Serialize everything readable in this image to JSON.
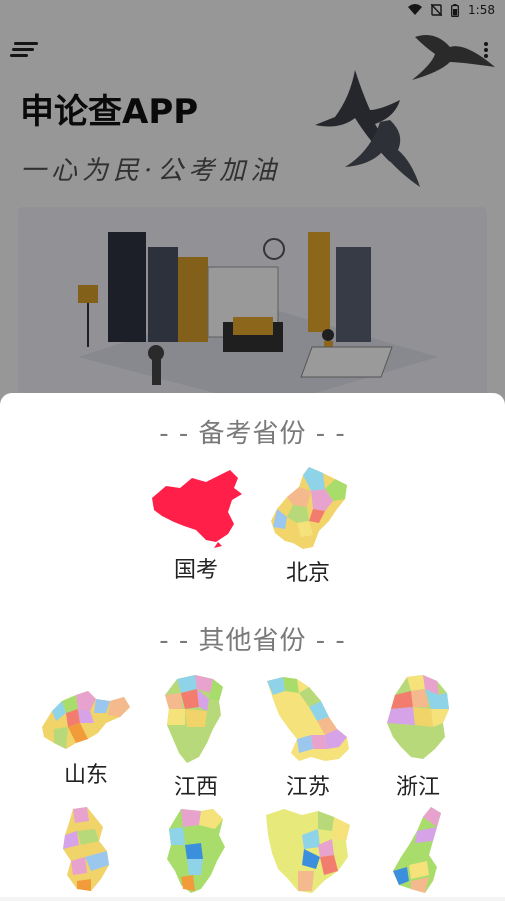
{
  "status_bar": {
    "time": "1:58"
  },
  "header": {
    "title": "申论查APP",
    "slogan": "一心为民·公考加油"
  },
  "sheet": {
    "exam_section_title": "- - 备考省份 - -",
    "other_section_title": "- - 其他省份 - -",
    "exam_provinces": [
      {
        "name": "国考",
        "icon": "china-map-icon",
        "color": "#ff1f48"
      },
      {
        "name": "北京",
        "icon": "beijing-map-icon"
      }
    ],
    "other_provinces": [
      {
        "name": "山东",
        "icon": "shandong-map-icon"
      },
      {
        "name": "江西",
        "icon": "jiangxi-map-icon"
      },
      {
        "name": "江苏",
        "icon": "jiangsu-map-icon"
      },
      {
        "name": "浙江",
        "icon": "zhejiang-map-icon"
      },
      {
        "name": "",
        "icon": "province-map-icon"
      },
      {
        "name": "",
        "icon": "province-map-icon"
      },
      {
        "name": "",
        "icon": "province-map-icon"
      },
      {
        "name": "",
        "icon": "province-map-icon"
      }
    ]
  }
}
